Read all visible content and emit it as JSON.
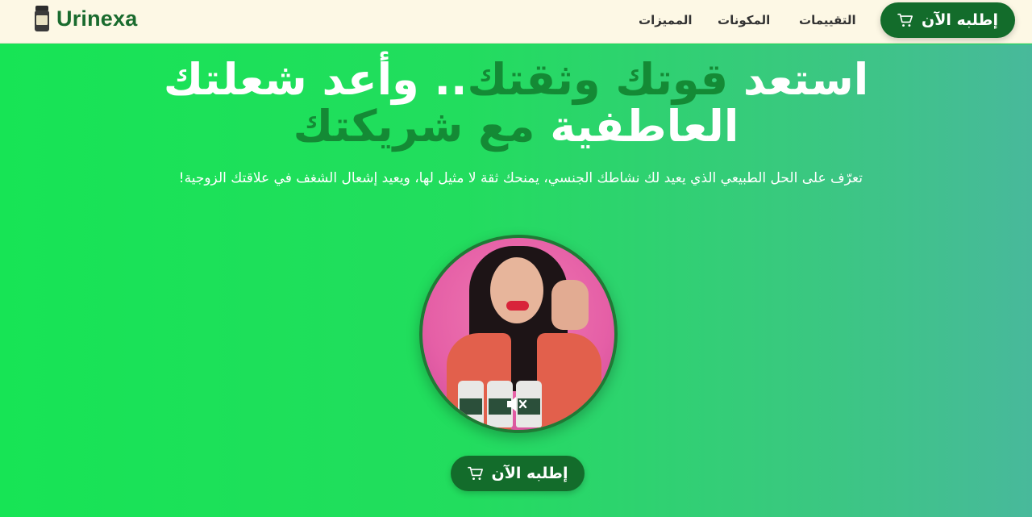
{
  "brand": {
    "name": "Urinexa"
  },
  "nav": {
    "reviews": "التقييمات",
    "ingredients": "المكونات",
    "features": "المميزات"
  },
  "header_button": {
    "label": "إطلبه الآن",
    "icon": "cart-icon"
  },
  "hero": {
    "headline_part1": "استعد ",
    "headline_part2": "قوتك وثقتك",
    "headline_part3": ".. وأعد شعلتك العاطفية ",
    "headline_part4": "مع شريكتك",
    "subheadline": "تعرّف على الحل الطبيعي الذي يعيد لك نشاطك الجنسي، يمنحك ثقة لا مثيل لها، ويعيد إشعال الشغف في علاقتك الزوجية!",
    "video_icon": "mute-icon"
  },
  "cta_button": {
    "label": "إطلبه الآن",
    "icon": "cart-icon"
  },
  "colors": {
    "header_bg": "#fdf8e5",
    "brand_green": "#136c2b",
    "hero_start": "#17e455",
    "hero_end": "#48b99b",
    "headline_accent": "#148a35"
  }
}
